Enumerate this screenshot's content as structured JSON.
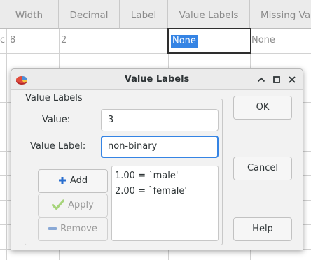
{
  "sheet": {
    "columns": [
      "Width",
      "Decimal",
      "Label",
      "Value Labels",
      "Missing Va"
    ],
    "row": {
      "edge_text": "c",
      "width": "8",
      "decimal": "2",
      "label": "",
      "value_labels": "None",
      "missing": "None"
    }
  },
  "dialog": {
    "title": "Value Labels",
    "group_title": "Value Labels",
    "value_label": "Value:",
    "value_input": "3",
    "value_label_label": "Value Label:",
    "value_label_input": "non-binary",
    "buttons": {
      "add": "Add",
      "apply": "Apply",
      "remove": "Remove",
      "ok": "OK",
      "cancel": "Cancel",
      "help": "Help"
    },
    "list_items": [
      "1.00 = `male'",
      "2.00 = `female'"
    ],
    "window_controls": {
      "minimize": "chevron-up-icon",
      "maximize": "maximize-icon",
      "close": "close-icon"
    }
  },
  "colors": {
    "accent": "#3584e4",
    "add_icon": "#2a6fcf",
    "apply_icon": "#73b640"
  }
}
